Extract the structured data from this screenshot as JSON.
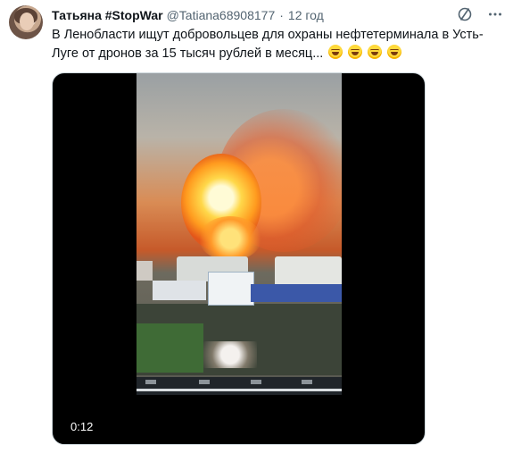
{
  "tweet": {
    "display_name": "Татьяна #StopWar",
    "handle": "@Tatiana68908177",
    "separator": "·",
    "time": "12 год",
    "text": "В Ленобласти ищут добровольцев для охраны нефтетерминала в Усть-Луге от дронов за 15 тысяч рублей в месяц...",
    "emoji_count": 4,
    "emoji_name": "grinning-squinting-face"
  },
  "media": {
    "type": "video",
    "duration": "0:12"
  },
  "icons": {
    "grok": "slash-circle-icon",
    "more": "more-dots-icon"
  },
  "colors": {
    "text": "#0f1419",
    "secondary": "#536471",
    "border": "#cfd9de"
  }
}
